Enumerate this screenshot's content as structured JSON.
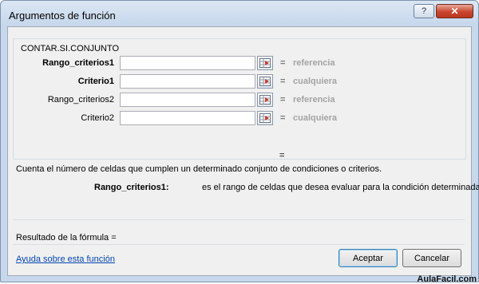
{
  "window": {
    "title": "Argumentos de función",
    "help_glyph": "?",
    "close_glyph": "✕"
  },
  "function_name": "CONTAR.SI.CONJUNTO",
  "arguments": [
    {
      "label": "Rango_criterios1",
      "bold": true,
      "value": "",
      "eq": "=",
      "hint": "referencia"
    },
    {
      "label": "Criterio1",
      "bold": true,
      "value": "",
      "eq": "=",
      "hint": "cualquiera"
    },
    {
      "label": "Rango_criterios2",
      "bold": false,
      "value": "",
      "eq": "=",
      "hint": "referencia"
    },
    {
      "label": "Criterio2",
      "bold": false,
      "value": "",
      "eq": "=",
      "hint": "cualquiera"
    }
  ],
  "result_eq": "=",
  "description": "Cuenta el número de celdas que cumplen un determinado conjunto de condiciones o criterios.",
  "arg_description": {
    "name": "Rango_criterios1:",
    "text": "es el rango de celdas que desea evaluar para la condición determinada."
  },
  "formula_result_label": "Resultado de la fórmula =",
  "help_link": "Ayuda sobre esta función",
  "buttons": {
    "ok": "Aceptar",
    "cancel": "Cancelar"
  },
  "watermark": "AulaFacil.com",
  "icons": {
    "collapse": "range-collapse-icon"
  }
}
